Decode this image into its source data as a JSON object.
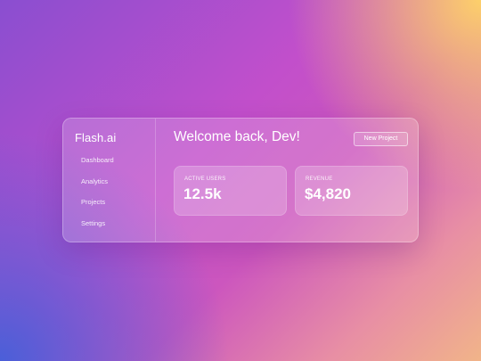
{
  "app": {
    "brand": "Flash.ai"
  },
  "sidebar": {
    "items": [
      {
        "label": "Dashboard"
      },
      {
        "label": "Analytics"
      },
      {
        "label": "Projects"
      },
      {
        "label": "Settings"
      }
    ]
  },
  "header": {
    "title": "Welcome back, Dev!",
    "new_project_label": "New Project"
  },
  "stats": [
    {
      "label": "ACTIVE USERS",
      "value": "12.5k"
    },
    {
      "label": "REVENUE",
      "value": "$4,820"
    }
  ],
  "colors": {
    "background_top_right": "#fdd06a",
    "background_center": "#c24fcb",
    "background_bottom_left": "#4a5fd8",
    "text": "#ffffff"
  }
}
